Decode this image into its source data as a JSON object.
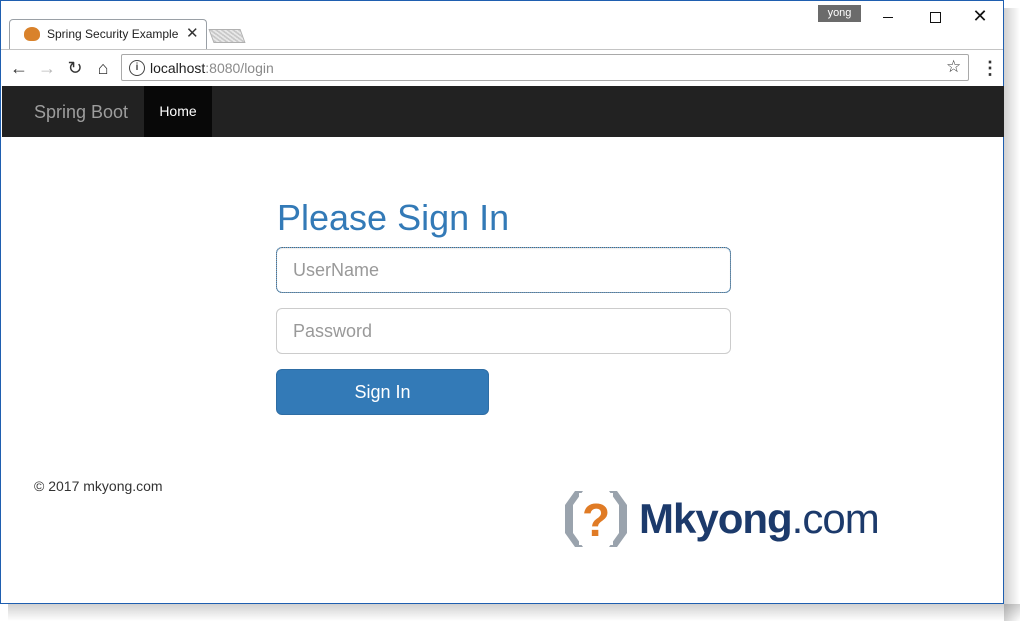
{
  "browser": {
    "tab_title": "Spring Security Example",
    "tab_close": "✕",
    "profile_name": "yong",
    "url_host": "localhost",
    "url_rest": ":8080/login",
    "icons": {
      "back": "back-arrow-icon",
      "forward": "forward-arrow-icon",
      "reload": "reload-icon",
      "home": "home-icon",
      "info": "info-icon",
      "star": "bookmark-star-icon",
      "menu": "kebab-menu-icon"
    }
  },
  "navbar": {
    "brand": "Spring Boot",
    "home_link": "Home",
    "bg_color": "#222222"
  },
  "login": {
    "title": "Please Sign In",
    "username_placeholder": "UserName",
    "username_value": "",
    "password_placeholder": "Password",
    "password_value": "",
    "submit_label": "Sign In",
    "accent_color": "#337ab7"
  },
  "footer": {
    "copyright": "© 2017 mkyong.com"
  },
  "logo": {
    "name": "Mkyong",
    "tld": ".com"
  }
}
